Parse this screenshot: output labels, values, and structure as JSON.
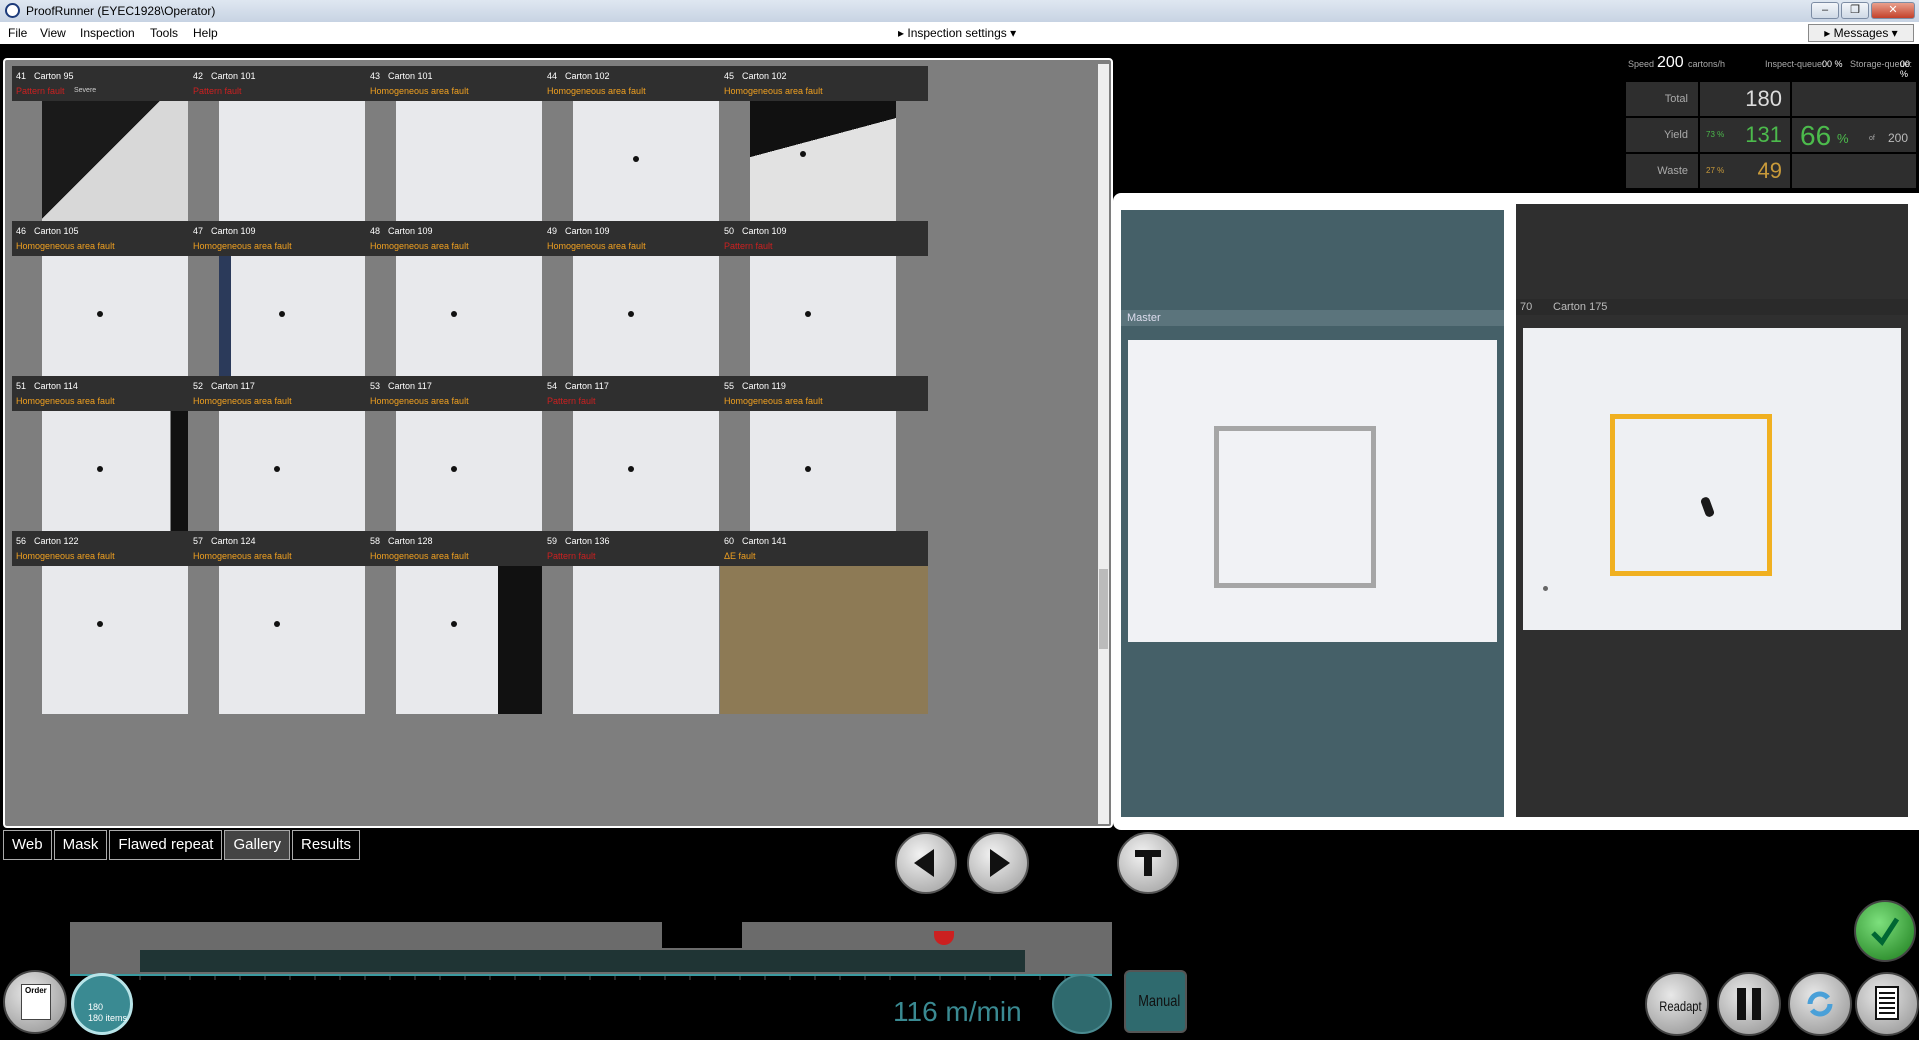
{
  "window": {
    "title": "ProofRunner  (EYEC1928\\Operator)",
    "controls": [
      "–",
      "❐",
      "✕"
    ]
  },
  "menu": {
    "items": [
      "File",
      "View",
      "Inspection",
      "Tools",
      "Help"
    ],
    "inspection_settings": "▸ Inspection settings ▾",
    "messages": "▸ Messages ▾"
  },
  "tiles": [
    {
      "num": "41",
      "carton": "Carton 95",
      "fault": "Pattern fault",
      "severity": "Severe",
      "color": "#cc2020"
    },
    {
      "num": "42",
      "carton": "Carton 101",
      "fault": "Pattern fault",
      "color": "#cc2020"
    },
    {
      "num": "43",
      "carton": "Carton 101",
      "fault": "Homogeneous area fault",
      "color": "#f0a020"
    },
    {
      "num": "44",
      "carton": "Carton 102",
      "fault": "Homogeneous area fault",
      "color": "#f0a020"
    },
    {
      "num": "45",
      "carton": "Carton 102",
      "fault": "Homogeneous area fault",
      "color": "#f0a020"
    },
    {
      "num": "46",
      "carton": "Carton 105",
      "fault": "Homogeneous area fault",
      "color": "#f0a020"
    },
    {
      "num": "47",
      "carton": "Carton 109",
      "fault": "Homogeneous area fault",
      "color": "#f0a020"
    },
    {
      "num": "48",
      "carton": "Carton 109",
      "fault": "Homogeneous area fault",
      "color": "#f0a020"
    },
    {
      "num": "49",
      "carton": "Carton 109",
      "fault": "Homogeneous area fault",
      "color": "#f0a020"
    },
    {
      "num": "50",
      "carton": "Carton 109",
      "fault": "Pattern fault",
      "color": "#cc2020"
    },
    {
      "num": "51",
      "carton": "Carton 114",
      "fault": "Homogeneous area fault",
      "color": "#f0a020"
    },
    {
      "num": "52",
      "carton": "Carton 117",
      "fault": "Homogeneous area fault",
      "color": "#f0a020"
    },
    {
      "num": "53",
      "carton": "Carton 117",
      "fault": "Homogeneous area fault",
      "color": "#f0a020"
    },
    {
      "num": "54",
      "carton": "Carton 117",
      "fault": "Pattern fault",
      "color": "#cc2020"
    },
    {
      "num": "55",
      "carton": "Carton 119",
      "fault": "Homogeneous area fault",
      "color": "#f0a020"
    },
    {
      "num": "56",
      "carton": "Carton 122",
      "fault": "Homogeneous area fault",
      "color": "#f0a020"
    },
    {
      "num": "57",
      "carton": "Carton 124",
      "fault": "Homogeneous area fault",
      "color": "#f0a020"
    },
    {
      "num": "58",
      "carton": "Carton 128",
      "fault": "Homogeneous area fault",
      "color": "#f0a020"
    },
    {
      "num": "59",
      "carton": "Carton 136",
      "fault": "Pattern fault",
      "color": "#cc2020"
    },
    {
      "num": "60",
      "carton": "Carton 141",
      "fault": "ΔE fault",
      "color": "#f0a020"
    }
  ],
  "tabs": [
    "Web",
    "Mask",
    "Flawed repeat",
    "Gallery",
    "Results"
  ],
  "active_tab": "Gallery",
  "stats": {
    "speed_label": "Speed",
    "speed_value": "200",
    "speed_unit": "cartons/h",
    "inspect_queue_label": "Inspect-queue:",
    "inspect_queue_value": "00 %",
    "storage_queue_label": "Storage-queue:",
    "storage_queue_value": "00 %",
    "total_label": "Total",
    "total_value": "180",
    "yield_label": "Yield",
    "yield_pct": "73 %",
    "yield_value": "131",
    "yield_big": "66",
    "yield_big_unit": "%",
    "yield_of": "of",
    "yield_target": "200",
    "waste_label": "Waste",
    "waste_pct": "27 %",
    "waste_value": "49"
  },
  "viewer": {
    "master_label": "Master",
    "carton_num": "70",
    "carton_name": "Carton 175"
  },
  "bottom": {
    "order_label": "Order",
    "counter_top": "180",
    "counter_bottom": "180 items",
    "speed": "116 m/min",
    "manual": "Manual",
    "readapt": "Readapt"
  },
  "colors": {
    "fault_orange": "#f0a020",
    "fault_red": "#cc2020",
    "yield_green": "#4cbb4c",
    "waste_amber": "#c89a3a",
    "master_panel": "#456068",
    "accent_teal": "#3a9aa0"
  }
}
